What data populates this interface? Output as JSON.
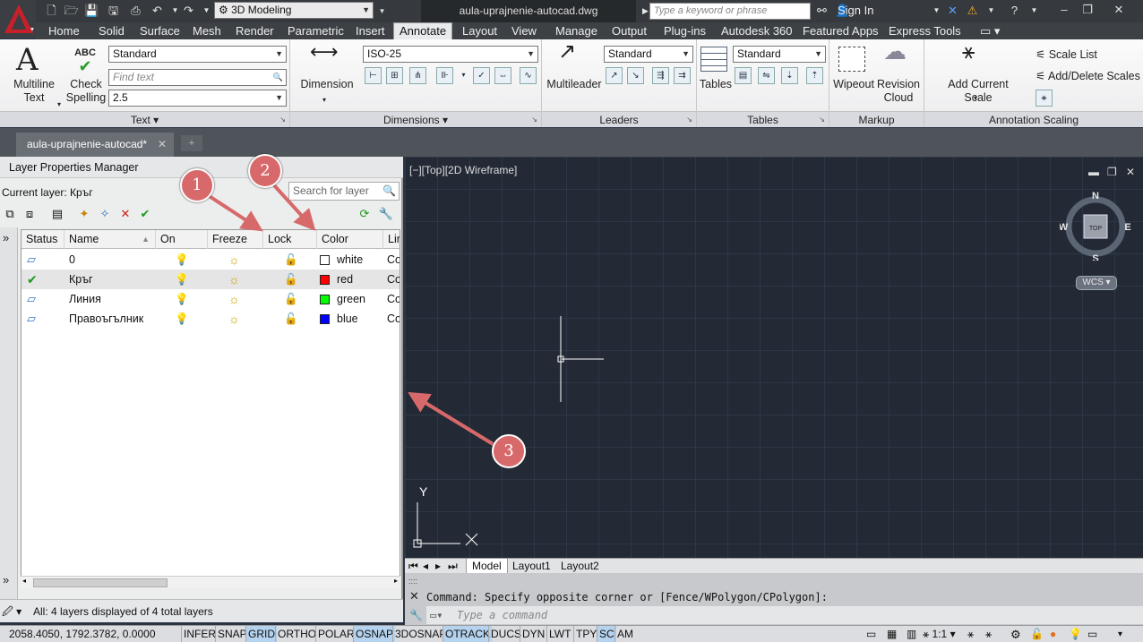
{
  "titlebar": {
    "workspace": "3D Modeling",
    "filename": "aula-uprajnenie-autocad.dwg",
    "search_placeholder": "Type a keyword or phrase",
    "signin": "Sign In"
  },
  "menu": [
    "Home",
    "Solid",
    "Surface",
    "Mesh",
    "Render",
    "Parametric",
    "Insert",
    "Annotate",
    "Layout",
    "View",
    "Manage",
    "Output",
    "Plug-ins",
    "Autodesk 360",
    "Featured Apps",
    "Express Tools"
  ],
  "active_menu": "Annotate",
  "ribbon": {
    "text": {
      "title": "Text",
      "multiline_1": "Multiline",
      "multiline_2": "Text",
      "check_1": "Check",
      "check_2": "Spelling",
      "abc": "ABC",
      "style": "Standard",
      "find": "Find text",
      "height": "2.5"
    },
    "dimensions": {
      "title": "Dimensions",
      "dimension": "Dimension",
      "style": "ISO-25"
    },
    "leaders": {
      "title": "Leaders",
      "multileader": "Multileader",
      "style": "Standard"
    },
    "tables": {
      "title": "Tables",
      "table": "Table",
      "style": "Standard"
    },
    "markup": {
      "title": "Markup",
      "wipeout": "Wipeout",
      "revision_1": "Revision",
      "revision_2": "Cloud"
    },
    "annotation": {
      "title": "Annotation Scaling",
      "add_current": "Add Current Scale",
      "scale_list": "Scale List",
      "add_delete": "Add/Delete Scales"
    }
  },
  "doc_tab": "aula-uprajnenie-autocad*",
  "layer_manager": {
    "title": "Layer Properties Manager",
    "current_layer": "Current layer: Кръг",
    "search_placeholder": "Search for layer",
    "columns": [
      "Status",
      "Name",
      "On",
      "Freeze",
      "Lock",
      "Color",
      "Lin"
    ],
    "rows": [
      {
        "name": "0",
        "color_name": "white",
        "color": "#ffffff",
        "linetype": "Co",
        "current": false,
        "selected": false
      },
      {
        "name": "Кръг",
        "color_name": "red",
        "color": "#ff0000",
        "linetype": "Co",
        "current": true,
        "selected": true
      },
      {
        "name": "Линия",
        "color_name": "green",
        "color": "#00ff00",
        "linetype": "Co",
        "current": false,
        "selected": false
      },
      {
        "name": "Правоъгълник",
        "color_name": "blue",
        "color": "#0000ff",
        "linetype": "Co",
        "current": false,
        "selected": false
      }
    ],
    "status": "All: 4 layers displayed of 4 total layers"
  },
  "viewport": {
    "label": "[−][Top][2D Wireframe]",
    "compass": {
      "n": "N",
      "s": "S",
      "e": "E",
      "w": "W",
      "top": "TOP"
    },
    "wcs": "WCS",
    "ucs_y": "Y"
  },
  "layout_tabs": [
    "Model",
    "Layout1",
    "Layout2"
  ],
  "command": {
    "history": "Command: Specify opposite corner or [Fence/WPolygon/CPolygon]:",
    "placeholder": "Type a command"
  },
  "statusbar": {
    "coords": "2058.4050, 1792.3782, 0.0000",
    "buttons": [
      {
        "label": "INFER",
        "on": false
      },
      {
        "label": "SNAP",
        "on": false
      },
      {
        "label": "GRID",
        "on": true
      },
      {
        "label": "ORTHO",
        "on": false
      },
      {
        "label": "POLAR",
        "on": false
      },
      {
        "label": "OSNAP",
        "on": true
      },
      {
        "label": "3DOSNAP",
        "on": false
      },
      {
        "label": "OTRACK",
        "on": true
      },
      {
        "label": "DUCS",
        "on": false
      },
      {
        "label": "DYN",
        "on": false
      },
      {
        "label": "LWT",
        "on": false
      },
      {
        "label": "TPY",
        "on": false
      },
      {
        "label": "SC",
        "on": true
      },
      {
        "label": "AM",
        "on": false
      }
    ],
    "scale": "1:1"
  },
  "callouts": [
    "1",
    "2",
    "3"
  ],
  "colors": {
    "accent_callout": "#d7696b",
    "viewport_bg": "#232a36"
  }
}
